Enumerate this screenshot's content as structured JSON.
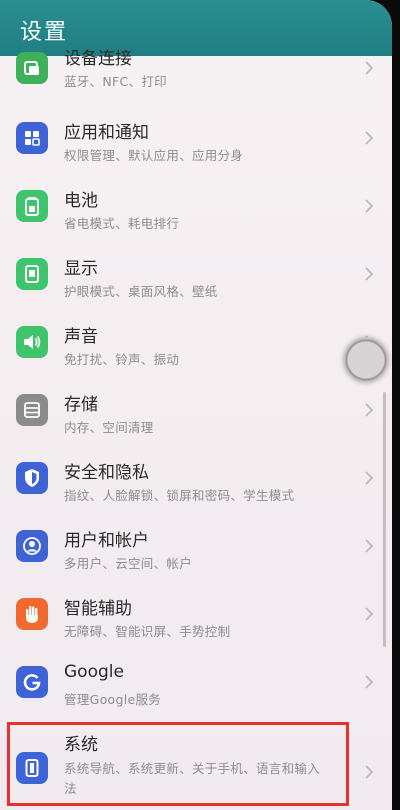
{
  "header": {
    "title": "设置"
  },
  "colors": {
    "header_bg": "#1f7e82",
    "highlight_border": "#e8312f"
  },
  "rows": [
    {
      "title": "设备连接",
      "subtitle": "蓝牙、NFC、打印",
      "icon": "device-connect-icon",
      "icon_color": "#3cb15a"
    },
    {
      "title": "应用和通知",
      "subtitle": "权限管理、默认应用、应用分身",
      "icon": "apps-icon",
      "icon_color": "#3d63d6"
    },
    {
      "title": "电池",
      "subtitle": "省电模式、耗电排行",
      "icon": "battery-icon",
      "icon_color": "#3ec46a"
    },
    {
      "title": "显示",
      "subtitle": "护眼模式、桌面风格、壁纸",
      "icon": "display-icon",
      "icon_color": "#3ec46a"
    },
    {
      "title": "声音",
      "subtitle": "免打扰、铃声、振动",
      "icon": "sound-icon",
      "icon_color": "#3ec46a"
    },
    {
      "title": "存储",
      "subtitle": "内存、空间清理",
      "icon": "storage-icon",
      "icon_color": "#8b8b8b"
    },
    {
      "title": "安全和隐私",
      "subtitle": "指纹、人脸解锁、锁屏和密码、学生模式",
      "icon": "shield-icon",
      "icon_color": "#3d63d6"
    },
    {
      "title": "用户和帐户",
      "subtitle": "多用户、云空间、帐户",
      "icon": "user-icon",
      "icon_color": "#3d63d6"
    },
    {
      "title": "智能辅助",
      "subtitle": "无障碍、智能识屏、手势控制",
      "icon": "hand-icon",
      "icon_color": "#ef6a2c"
    },
    {
      "title": "Google",
      "subtitle": "管理Google服务",
      "icon": "google-icon",
      "icon_color": "#3d63d6"
    },
    {
      "title": "系统",
      "subtitle": "系统导航、系统更新、关于手机、语言和输入",
      "subtitle_line2": "法",
      "icon": "system-icon",
      "icon_color": "#3d63d6"
    }
  ]
}
